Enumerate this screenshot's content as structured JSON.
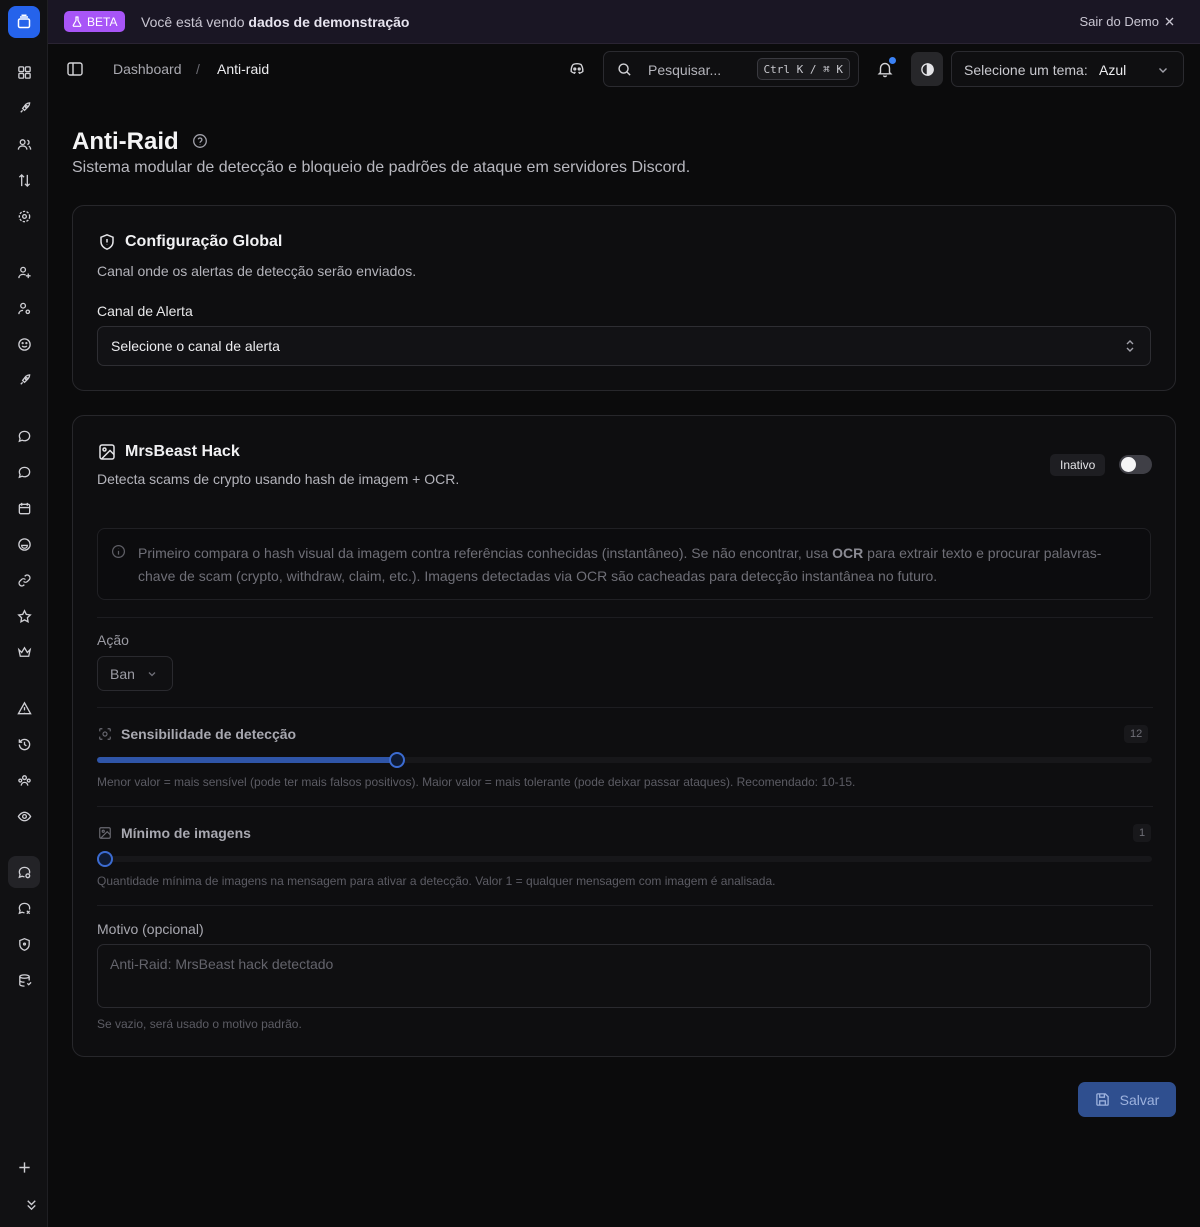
{
  "banner": {
    "beta_label": "BETA",
    "text_prefix": "Você está vendo",
    "text_bold": "dados de demonstração",
    "exit_label": "Sair do Demo"
  },
  "header": {
    "breadcrumb": [
      "Dashboard",
      "Anti-raid"
    ],
    "breadcrumb_separator": "/",
    "search_placeholder": "Pesquisar...",
    "search_shortcut": "Ctrl K / ⌘ K",
    "theme_label": "Selecione um tema:",
    "theme_value": "Azul"
  },
  "page": {
    "title": "Anti-Raid",
    "subtitle": "Sistema modular de detecção e bloqueio de padrões de ataque em servidores Discord."
  },
  "global_config": {
    "title": "Configuração Global",
    "description": "Canal onde os alertas de detecção serão enviados.",
    "channel_label": "Canal de Alerta",
    "channel_placeholder": "Selecione o canal de alerta"
  },
  "module": {
    "title": "MrsBeast Hack",
    "description": "Detecta scams de crypto usando hash de imagem + OCR.",
    "status": "Inativo",
    "enabled": false,
    "info_part1": "Primeiro compara o hash visual da imagem contra referências conhecidas (instantâneo). Se não encontrar, usa ",
    "info_bold": "OCR",
    "info_part2": " para extrair texto e procurar palavras-chave de scam (crypto, withdraw, claim, etc.). Imagens detectadas via OCR são cacheadas para detecção instantânea no futuro.",
    "action_label": "Ação",
    "action_value": "Ban",
    "sensitivity_label": "Sensibilidade de detecção",
    "sensitivity_value": "12",
    "sensitivity_fraction": 0.284,
    "sensitivity_help": "Menor valor = mais sensível (pode ter mais falsos positivos). Maior valor = mais tolerante (pode deixar passar ataques). Recomendado: 10-15.",
    "min_images_label": "Mínimo de imagens",
    "min_images_value": "1",
    "min_images_fraction": 0,
    "min_images_help": "Quantidade mínima de imagens na mensagem para ativar a detecção. Valor 1 = qualquer mensagem com imagem é analisada.",
    "reason_label": "Motivo (opcional)",
    "reason_placeholder": "Anti-Raid: MrsBeast hack detectado",
    "reason_help": "Se vazio, será usado o motivo padrão."
  },
  "save_label": "Salvar",
  "colors": {
    "accent": "#2563eb",
    "beta": "#a855f7",
    "slider_fill": "#2f55a8"
  }
}
